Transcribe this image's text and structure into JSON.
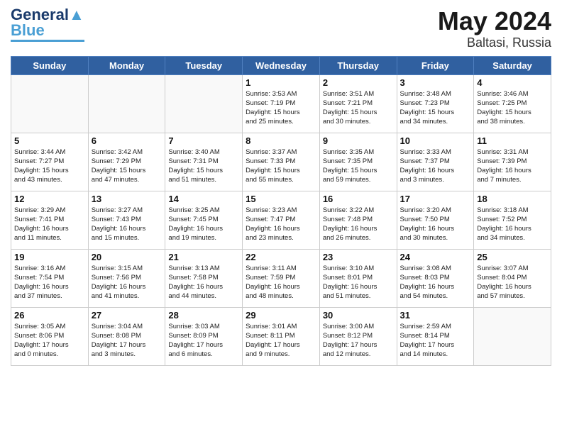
{
  "header": {
    "logo_line1": "General",
    "logo_line2": "Blue",
    "month": "May 2024",
    "location": "Baltasi, Russia"
  },
  "days_of_week": [
    "Sunday",
    "Monday",
    "Tuesday",
    "Wednesday",
    "Thursday",
    "Friday",
    "Saturday"
  ],
  "weeks": [
    [
      {
        "day": "",
        "info": ""
      },
      {
        "day": "",
        "info": ""
      },
      {
        "day": "",
        "info": ""
      },
      {
        "day": "1",
        "info": "Sunrise: 3:53 AM\nSunset: 7:19 PM\nDaylight: 15 hours\nand 25 minutes."
      },
      {
        "day": "2",
        "info": "Sunrise: 3:51 AM\nSunset: 7:21 PM\nDaylight: 15 hours\nand 30 minutes."
      },
      {
        "day": "3",
        "info": "Sunrise: 3:48 AM\nSunset: 7:23 PM\nDaylight: 15 hours\nand 34 minutes."
      },
      {
        "day": "4",
        "info": "Sunrise: 3:46 AM\nSunset: 7:25 PM\nDaylight: 15 hours\nand 38 minutes."
      }
    ],
    [
      {
        "day": "5",
        "info": "Sunrise: 3:44 AM\nSunset: 7:27 PM\nDaylight: 15 hours\nand 43 minutes."
      },
      {
        "day": "6",
        "info": "Sunrise: 3:42 AM\nSunset: 7:29 PM\nDaylight: 15 hours\nand 47 minutes."
      },
      {
        "day": "7",
        "info": "Sunrise: 3:40 AM\nSunset: 7:31 PM\nDaylight: 15 hours\nand 51 minutes."
      },
      {
        "day": "8",
        "info": "Sunrise: 3:37 AM\nSunset: 7:33 PM\nDaylight: 15 hours\nand 55 minutes."
      },
      {
        "day": "9",
        "info": "Sunrise: 3:35 AM\nSunset: 7:35 PM\nDaylight: 15 hours\nand 59 minutes."
      },
      {
        "day": "10",
        "info": "Sunrise: 3:33 AM\nSunset: 7:37 PM\nDaylight: 16 hours\nand 3 minutes."
      },
      {
        "day": "11",
        "info": "Sunrise: 3:31 AM\nSunset: 7:39 PM\nDaylight: 16 hours\nand 7 minutes."
      }
    ],
    [
      {
        "day": "12",
        "info": "Sunrise: 3:29 AM\nSunset: 7:41 PM\nDaylight: 16 hours\nand 11 minutes."
      },
      {
        "day": "13",
        "info": "Sunrise: 3:27 AM\nSunset: 7:43 PM\nDaylight: 16 hours\nand 15 minutes."
      },
      {
        "day": "14",
        "info": "Sunrise: 3:25 AM\nSunset: 7:45 PM\nDaylight: 16 hours\nand 19 minutes."
      },
      {
        "day": "15",
        "info": "Sunrise: 3:23 AM\nSunset: 7:47 PM\nDaylight: 16 hours\nand 23 minutes."
      },
      {
        "day": "16",
        "info": "Sunrise: 3:22 AM\nSunset: 7:48 PM\nDaylight: 16 hours\nand 26 minutes."
      },
      {
        "day": "17",
        "info": "Sunrise: 3:20 AM\nSunset: 7:50 PM\nDaylight: 16 hours\nand 30 minutes."
      },
      {
        "day": "18",
        "info": "Sunrise: 3:18 AM\nSunset: 7:52 PM\nDaylight: 16 hours\nand 34 minutes."
      }
    ],
    [
      {
        "day": "19",
        "info": "Sunrise: 3:16 AM\nSunset: 7:54 PM\nDaylight: 16 hours\nand 37 minutes."
      },
      {
        "day": "20",
        "info": "Sunrise: 3:15 AM\nSunset: 7:56 PM\nDaylight: 16 hours\nand 41 minutes."
      },
      {
        "day": "21",
        "info": "Sunrise: 3:13 AM\nSunset: 7:58 PM\nDaylight: 16 hours\nand 44 minutes."
      },
      {
        "day": "22",
        "info": "Sunrise: 3:11 AM\nSunset: 7:59 PM\nDaylight: 16 hours\nand 48 minutes."
      },
      {
        "day": "23",
        "info": "Sunrise: 3:10 AM\nSunset: 8:01 PM\nDaylight: 16 hours\nand 51 minutes."
      },
      {
        "day": "24",
        "info": "Sunrise: 3:08 AM\nSunset: 8:03 PM\nDaylight: 16 hours\nand 54 minutes."
      },
      {
        "day": "25",
        "info": "Sunrise: 3:07 AM\nSunset: 8:04 PM\nDaylight: 16 hours\nand 57 minutes."
      }
    ],
    [
      {
        "day": "26",
        "info": "Sunrise: 3:05 AM\nSunset: 8:06 PM\nDaylight: 17 hours\nand 0 minutes."
      },
      {
        "day": "27",
        "info": "Sunrise: 3:04 AM\nSunset: 8:08 PM\nDaylight: 17 hours\nand 3 minutes."
      },
      {
        "day": "28",
        "info": "Sunrise: 3:03 AM\nSunset: 8:09 PM\nDaylight: 17 hours\nand 6 minutes."
      },
      {
        "day": "29",
        "info": "Sunrise: 3:01 AM\nSunset: 8:11 PM\nDaylight: 17 hours\nand 9 minutes."
      },
      {
        "day": "30",
        "info": "Sunrise: 3:00 AM\nSunset: 8:12 PM\nDaylight: 17 hours\nand 12 minutes."
      },
      {
        "day": "31",
        "info": "Sunrise: 2:59 AM\nSunset: 8:14 PM\nDaylight: 17 hours\nand 14 minutes."
      },
      {
        "day": "",
        "info": ""
      }
    ]
  ]
}
